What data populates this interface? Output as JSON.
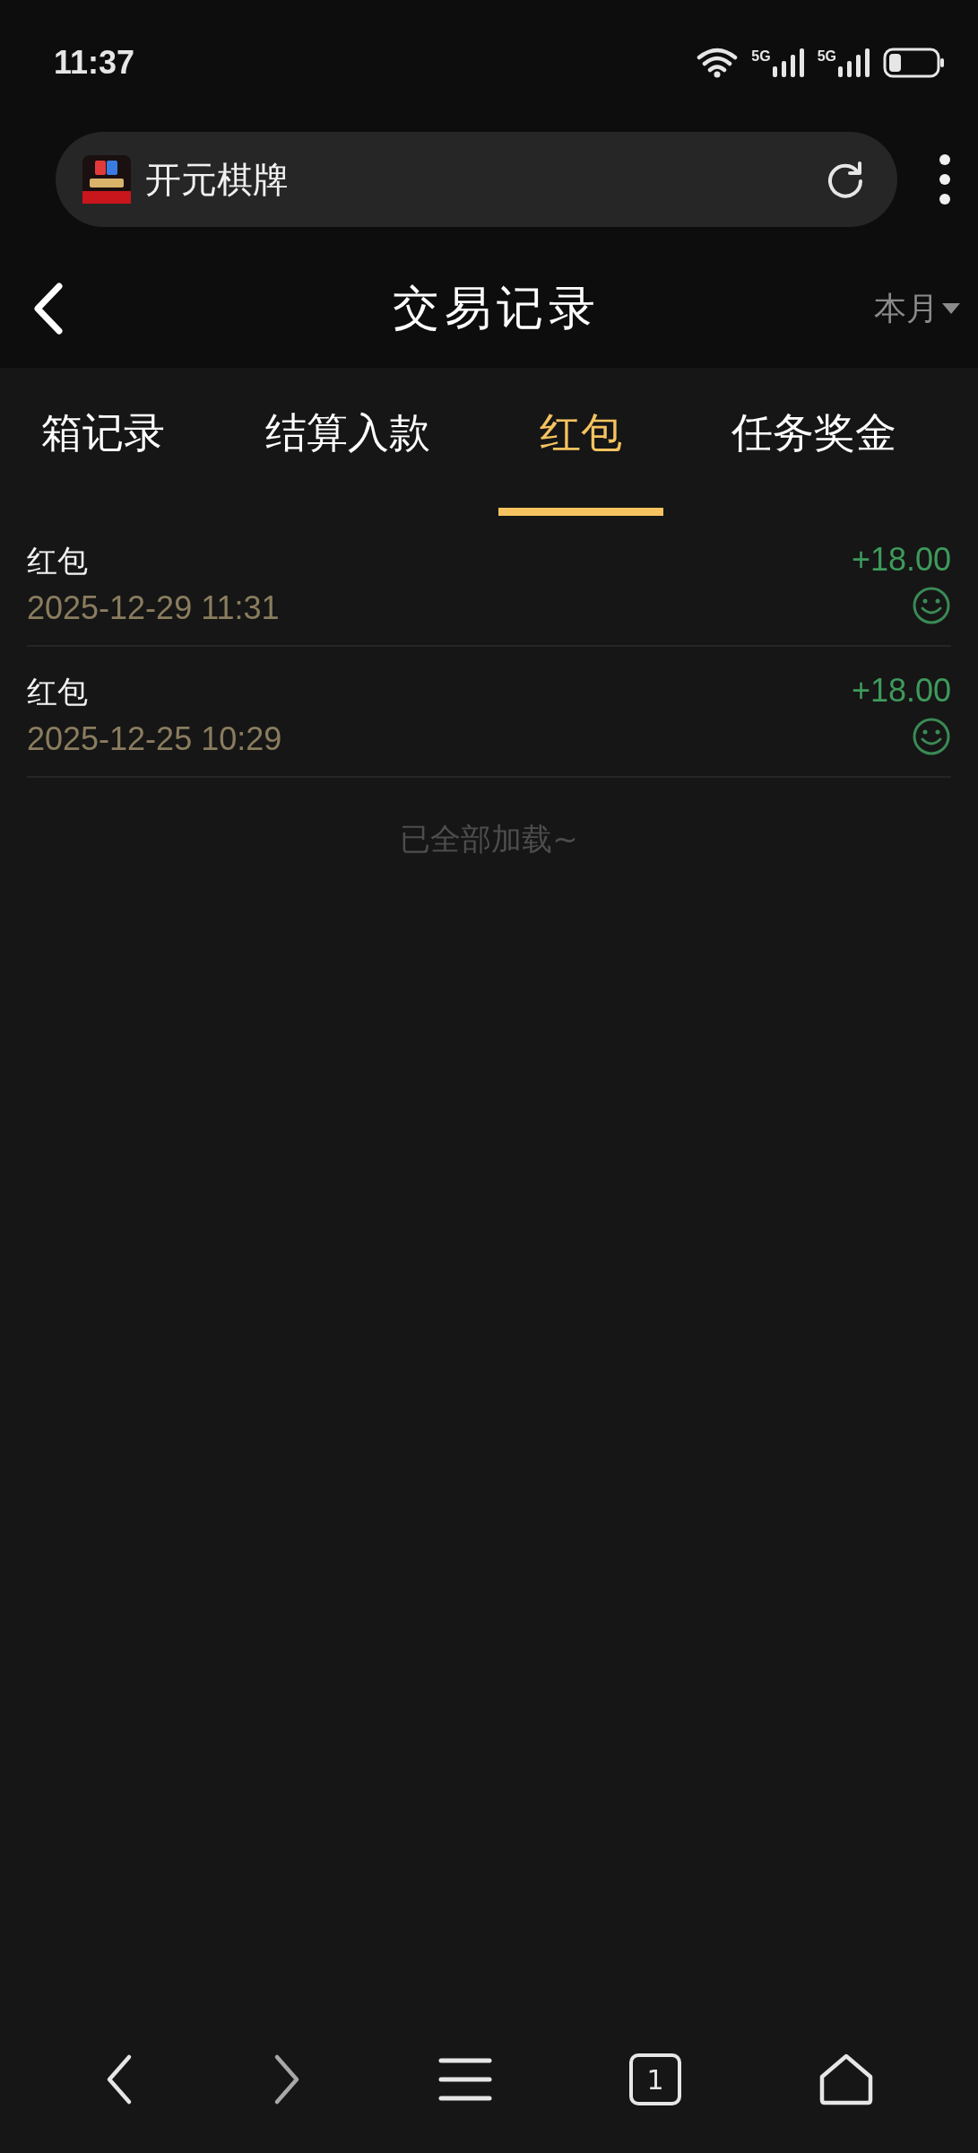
{
  "status_bar": {
    "time": "11:37",
    "networks": [
      "5G",
      "5G"
    ]
  },
  "browser": {
    "site_title": "开元棋牌"
  },
  "header": {
    "title": "交易记录",
    "filter": "本月"
  },
  "tabs": [
    {
      "label": "箱记录",
      "selected": false
    },
    {
      "label": "结算入款",
      "selected": false
    },
    {
      "label": "红包",
      "selected": true
    },
    {
      "label": "任务奖金",
      "selected": false
    }
  ],
  "records": [
    {
      "title": "红包",
      "date": "2025-12-29 11:31",
      "amount": "+18.00"
    },
    {
      "title": "红包",
      "date": "2025-12-25 10:29",
      "amount": "+18.00"
    }
  ],
  "footer_note": "已全部加载~",
  "bottom_nav": {
    "tab_count": "1"
  }
}
